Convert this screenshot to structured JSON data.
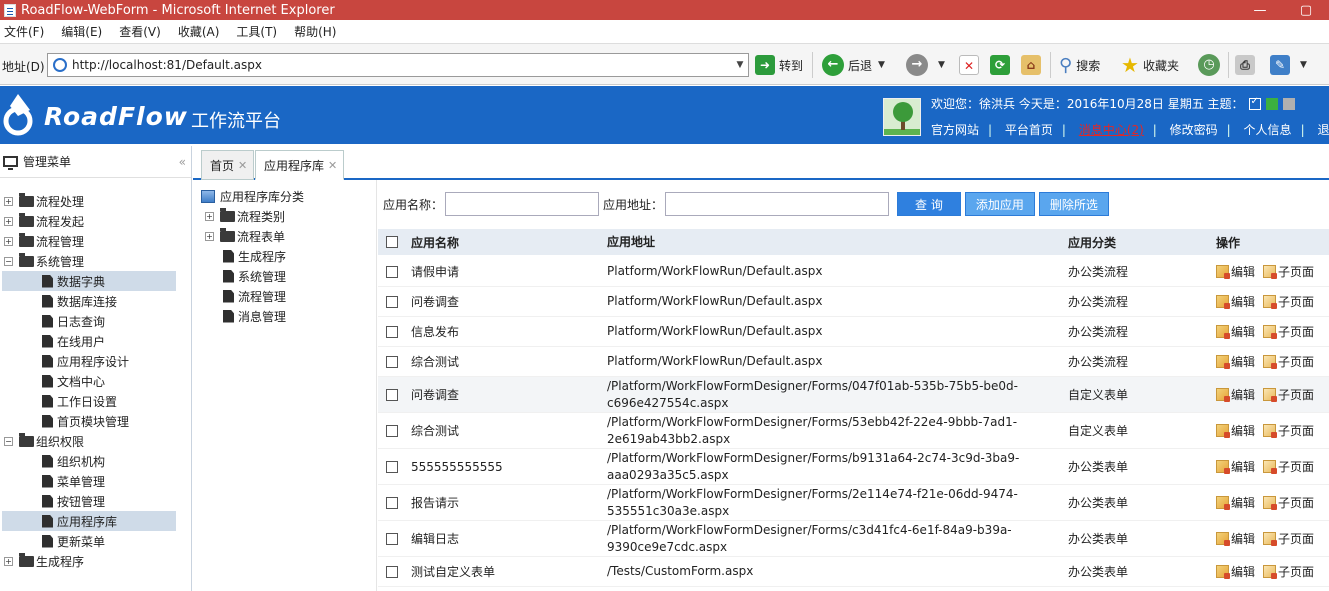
{
  "window": {
    "title": "RoadFlow-WebForm - Microsoft Internet Explorer",
    "buttons": [
      "—",
      "▢"
    ]
  },
  "menubar": [
    "文件(F)",
    "编辑(E)",
    "查看(V)",
    "收藏(A)",
    "工具(T)",
    "帮助(H)"
  ],
  "addressbar": {
    "label": "地址(D)",
    "url": "http://localhost:81/Default.aspx",
    "go": "转到",
    "back": "后退",
    "search": "搜索",
    "favorites": "收藏夹"
  },
  "header": {
    "logo": "RoadFlow",
    "subtitle": "工作流平台",
    "welcome": "欢迎您：徐洪兵  今天是：2016年10月28日 星期五  主题：",
    "links": [
      "官方网站",
      "平台首页",
      "消息中心(2)",
      "修改密码",
      "个人信息",
      "退出系"
    ],
    "colors": {
      "header_bg": "#1a67c5",
      "message_link": "#e02828"
    }
  },
  "sidebar": {
    "title": "管理菜单",
    "collapse": "«",
    "items": [
      {
        "label": "流程处理",
        "level": 0,
        "expanded": false
      },
      {
        "label": "流程发起",
        "level": 0,
        "expanded": false
      },
      {
        "label": "流程管理",
        "level": 0,
        "expanded": false
      },
      {
        "label": "系统管理",
        "level": 0,
        "expanded": true
      },
      {
        "label": "数据字典",
        "level": 1,
        "selected": true
      },
      {
        "label": "数据库连接",
        "level": 1
      },
      {
        "label": "日志查询",
        "level": 1
      },
      {
        "label": "在线用户",
        "level": 1
      },
      {
        "label": "应用程序设计",
        "level": 1
      },
      {
        "label": "文档中心",
        "level": 1
      },
      {
        "label": "工作日设置",
        "level": 1
      },
      {
        "label": "首页模块管理",
        "level": 1
      },
      {
        "label": "组织权限",
        "level": 0,
        "expanded": true
      },
      {
        "label": "组织机构",
        "level": 1
      },
      {
        "label": "菜单管理",
        "level": 1
      },
      {
        "label": "按钮管理",
        "level": 1
      },
      {
        "label": "应用程序库",
        "level": 1,
        "selected": true
      },
      {
        "label": "更新菜单",
        "level": 1
      },
      {
        "label": "生成程序",
        "level": 0,
        "expanded": false
      }
    ]
  },
  "tabs": [
    {
      "label": "首页",
      "close": "✕"
    },
    {
      "label": "应用程序库",
      "close": "✕",
      "active": true
    }
  ],
  "categories": {
    "root": "应用程序库分类",
    "items": [
      {
        "label": "流程类别",
        "folder": true
      },
      {
        "label": "流程表单",
        "folder": true
      },
      {
        "label": "生成程序",
        "folder": false
      },
      {
        "label": "系统管理",
        "folder": false
      },
      {
        "label": "流程管理",
        "folder": false
      },
      {
        "label": "消息管理",
        "folder": false
      }
    ]
  },
  "search": {
    "name_label": "应用名称：",
    "addr_label": "应用地址：",
    "query": "查 询",
    "add": "添加应用",
    "delete": "删除所选"
  },
  "table": {
    "headers": [
      "应用名称",
      "应用地址",
      "应用分类",
      "操作"
    ],
    "rows": [
      {
        "name": "请假申请",
        "addr": "Platform/WorkFlowRun/Default.aspx",
        "cat": "办公类流程"
      },
      {
        "name": "问卷调查",
        "addr": "Platform/WorkFlowRun/Default.aspx",
        "cat": "办公类流程"
      },
      {
        "name": "信息发布",
        "addr": "Platform/WorkFlowRun/Default.aspx",
        "cat": "办公类流程"
      },
      {
        "name": "综合测试",
        "addr": "Platform/WorkFlowRun/Default.aspx",
        "cat": "办公类流程"
      },
      {
        "name": "问卷调查",
        "addr": "/Platform/WorkFlowFormDesigner/Forms/047f01ab-535b-75b5-be0d-c696e427554c.aspx",
        "cat": "自定义表单"
      },
      {
        "name": "综合测试",
        "addr": "/Platform/WorkFlowFormDesigner/Forms/53ebb42f-22e4-9bbb-7ad1-2e619ab43bb2.aspx",
        "cat": "自定义表单"
      },
      {
        "name": "555555555555",
        "addr": "/Platform/WorkFlowFormDesigner/Forms/b9131a64-2c74-3c9d-3ba9-aaa0293a35c5.aspx",
        "cat": "办公类表单"
      },
      {
        "name": "报告请示",
        "addr": "/Platform/WorkFlowFormDesigner/Forms/2e114e74-f21e-06dd-9474-535551c30a3e.aspx",
        "cat": "办公类表单"
      },
      {
        "name": "编辑日志",
        "addr": "/Platform/WorkFlowFormDesigner/Forms/c3d41fc4-6e1f-84a9-b39a-9390ce9e7cdc.aspx",
        "cat": "办公类表单"
      },
      {
        "name": "测试自定义表单",
        "addr": "/Tests/CustomForm.aspx",
        "cat": "办公类表单"
      }
    ],
    "op_edit": "编辑",
    "op_sub": "子页面"
  }
}
